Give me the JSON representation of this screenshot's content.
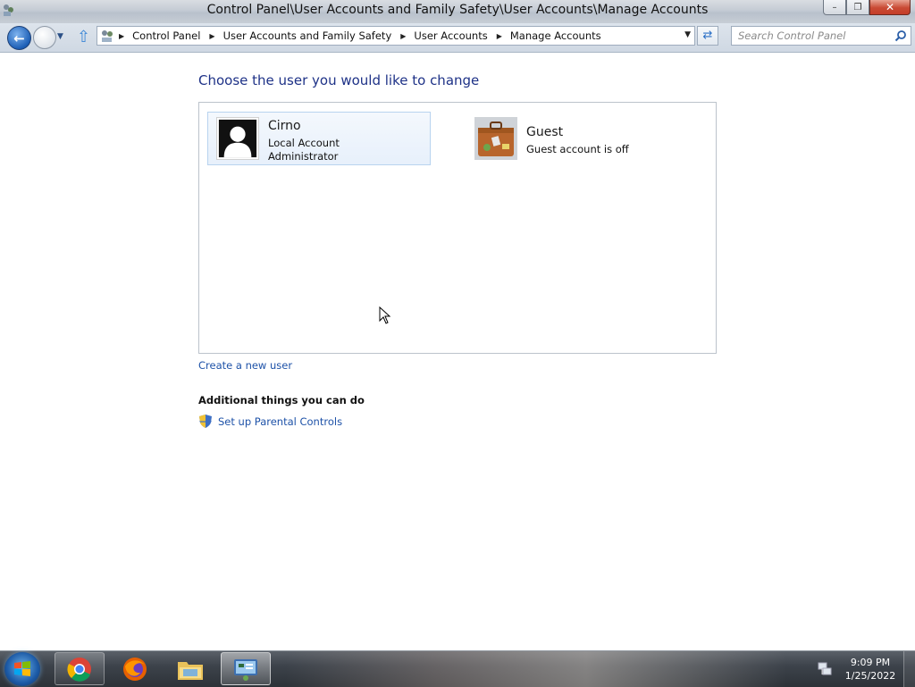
{
  "window": {
    "title": "Control Panel\\User Accounts and Family Safety\\User Accounts\\Manage Accounts",
    "minimize_label": "–",
    "maximize_label": "❐",
    "close_label": "✕"
  },
  "navbar": {
    "breadcrumbs": [
      "Control Panel",
      "User Accounts and Family Safety",
      "User Accounts",
      "Manage Accounts"
    ],
    "search_placeholder": "Search Control Panel"
  },
  "main": {
    "heading": "Choose the user you would like to change",
    "accounts": [
      {
        "name": "Cirno",
        "lines": [
          "Local Account",
          "Administrator"
        ],
        "avatar": "user-silhouette-icon"
      },
      {
        "name": "Guest",
        "lines": [
          "Guest account is off"
        ],
        "avatar": "suitcase-icon"
      }
    ],
    "create_user_link": "Create a new user",
    "additional_heading": "Additional things you can do",
    "parental_link": "Set up Parental Controls"
  },
  "taskbar": {
    "apps": [
      "chrome-icon",
      "firefox-icon",
      "file-explorer-icon",
      "control-panel-icon"
    ],
    "time": "9:09 PM",
    "date": "1/25/2022"
  }
}
